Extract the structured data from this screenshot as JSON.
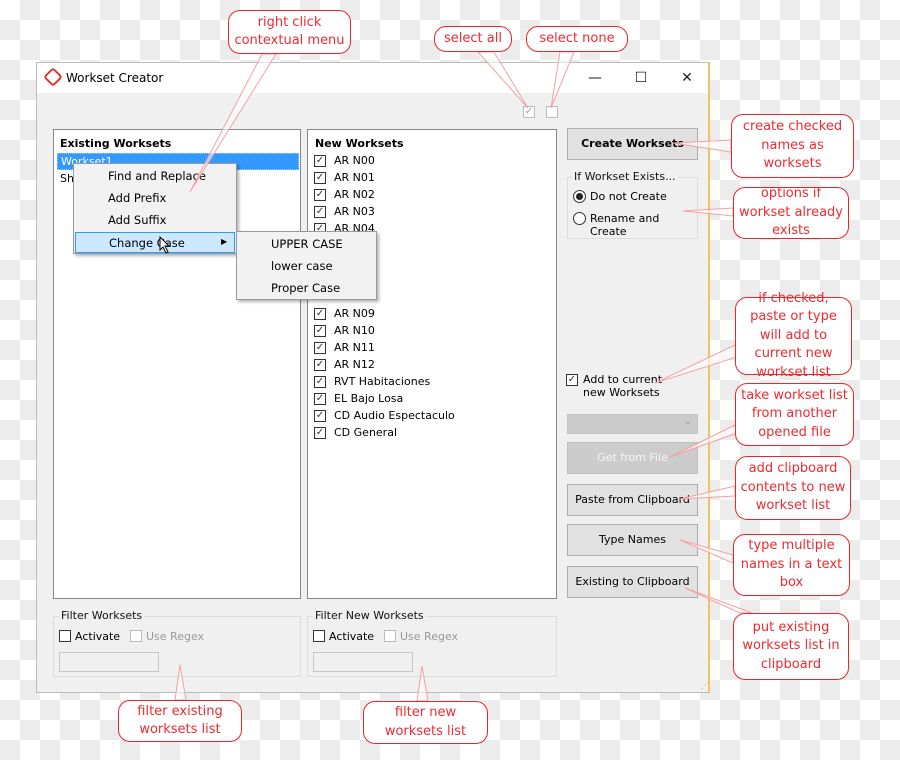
{
  "window": {
    "title": "Workset Creator",
    "minimize": "—",
    "maximize": "☐",
    "close": "✕"
  },
  "existing": {
    "title": "Existing Worksets",
    "items": [
      "Workset1",
      "Sh"
    ]
  },
  "context_menu": {
    "items": [
      "Find and Replace",
      "Add Prefix",
      "Add Suffix",
      "Change Case"
    ],
    "arrow": "▶",
    "submenu": [
      "UPPER CASE",
      "lower case",
      "Proper Case"
    ]
  },
  "new_worksets": {
    "title": "New Worksets",
    "items_top": [
      "AR N00",
      "AR N01",
      "AR N02",
      "AR N03",
      "AR N04"
    ],
    "items_bottom": [
      "AR N09",
      "AR N10",
      "AR N11",
      "AR N12",
      "RVT Habitaciones",
      "EL Bajo Losa",
      "CD Audio Espectaculo",
      "CD General"
    ],
    "all_checked": true
  },
  "select_all_checked": true,
  "select_none_checked": false,
  "right": {
    "create": "Create Worksets",
    "exists_group": "If Workset Exists...",
    "radio_options": [
      "Do not Create",
      "Rename and Create"
    ],
    "radio_selected": 0,
    "add_to_current_1": "Add to current",
    "add_to_current_2": "new Worksets",
    "add_to_current_checked": true,
    "dropdown_value": "",
    "get_from_file": "Get from File",
    "paste": "Paste from Clipboard",
    "type_names": "Type Names",
    "existing_to_clipboard": "Existing to Clipboard"
  },
  "filter_existing": {
    "title": "Filter Worksets",
    "activate": "Activate",
    "regex": "Use Regex",
    "value": ""
  },
  "filter_new": {
    "title": "Filter New Worksets",
    "activate": "Activate",
    "regex": "Use Regex",
    "value": ""
  },
  "callouts": {
    "right_click": "right click contextual menu",
    "select_all": "select all",
    "select_none": "select none",
    "create": "create checked names as worksets",
    "options": "options if workset already exists",
    "if_checked": "if checked, paste or type will add to current new workset list",
    "take_list": "take workset list from another opened file",
    "add_clipboard": "add clipboard contents to new workset list",
    "type_multiple": "type multiple names in a text box",
    "put_existing": "put existing worksets list in clipboard",
    "filter_existing": "filter existing worksets list",
    "filter_new": "filter new worksets list"
  },
  "colors": {
    "callout": "#e8262b",
    "selection": "#3399ff",
    "menu_highlight": "#cce8ff",
    "window_border": "#f4c060"
  }
}
